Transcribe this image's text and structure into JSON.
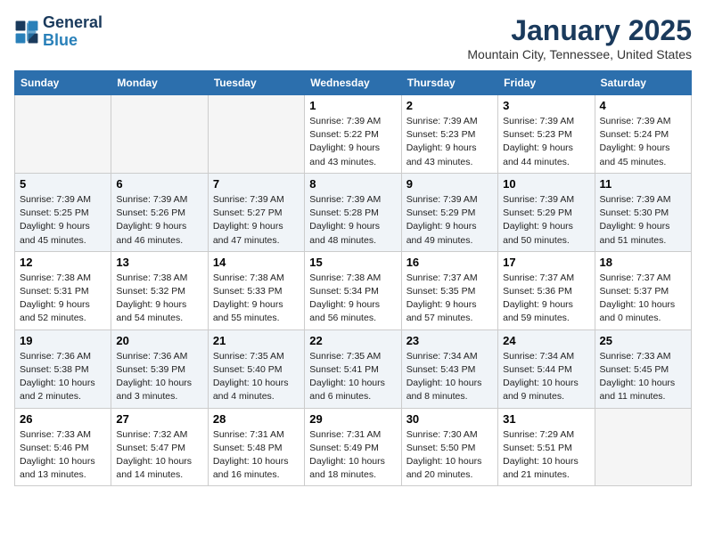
{
  "header": {
    "logo_line1": "General",
    "logo_line2": "Blue",
    "month_title": "January 2025",
    "location": "Mountain City, Tennessee, United States"
  },
  "days_of_week": [
    "Sunday",
    "Monday",
    "Tuesday",
    "Wednesday",
    "Thursday",
    "Friday",
    "Saturday"
  ],
  "weeks": [
    [
      {
        "day": "",
        "info": ""
      },
      {
        "day": "",
        "info": ""
      },
      {
        "day": "",
        "info": ""
      },
      {
        "day": "1",
        "info": "Sunrise: 7:39 AM\nSunset: 5:22 PM\nDaylight: 9 hours\nand 43 minutes."
      },
      {
        "day": "2",
        "info": "Sunrise: 7:39 AM\nSunset: 5:23 PM\nDaylight: 9 hours\nand 43 minutes."
      },
      {
        "day": "3",
        "info": "Sunrise: 7:39 AM\nSunset: 5:23 PM\nDaylight: 9 hours\nand 44 minutes."
      },
      {
        "day": "4",
        "info": "Sunrise: 7:39 AM\nSunset: 5:24 PM\nDaylight: 9 hours\nand 45 minutes."
      }
    ],
    [
      {
        "day": "5",
        "info": "Sunrise: 7:39 AM\nSunset: 5:25 PM\nDaylight: 9 hours\nand 45 minutes."
      },
      {
        "day": "6",
        "info": "Sunrise: 7:39 AM\nSunset: 5:26 PM\nDaylight: 9 hours\nand 46 minutes."
      },
      {
        "day": "7",
        "info": "Sunrise: 7:39 AM\nSunset: 5:27 PM\nDaylight: 9 hours\nand 47 minutes."
      },
      {
        "day": "8",
        "info": "Sunrise: 7:39 AM\nSunset: 5:28 PM\nDaylight: 9 hours\nand 48 minutes."
      },
      {
        "day": "9",
        "info": "Sunrise: 7:39 AM\nSunset: 5:29 PM\nDaylight: 9 hours\nand 49 minutes."
      },
      {
        "day": "10",
        "info": "Sunrise: 7:39 AM\nSunset: 5:29 PM\nDaylight: 9 hours\nand 50 minutes."
      },
      {
        "day": "11",
        "info": "Sunrise: 7:39 AM\nSunset: 5:30 PM\nDaylight: 9 hours\nand 51 minutes."
      }
    ],
    [
      {
        "day": "12",
        "info": "Sunrise: 7:38 AM\nSunset: 5:31 PM\nDaylight: 9 hours\nand 52 minutes."
      },
      {
        "day": "13",
        "info": "Sunrise: 7:38 AM\nSunset: 5:32 PM\nDaylight: 9 hours\nand 54 minutes."
      },
      {
        "day": "14",
        "info": "Sunrise: 7:38 AM\nSunset: 5:33 PM\nDaylight: 9 hours\nand 55 minutes."
      },
      {
        "day": "15",
        "info": "Sunrise: 7:38 AM\nSunset: 5:34 PM\nDaylight: 9 hours\nand 56 minutes."
      },
      {
        "day": "16",
        "info": "Sunrise: 7:37 AM\nSunset: 5:35 PM\nDaylight: 9 hours\nand 57 minutes."
      },
      {
        "day": "17",
        "info": "Sunrise: 7:37 AM\nSunset: 5:36 PM\nDaylight: 9 hours\nand 59 minutes."
      },
      {
        "day": "18",
        "info": "Sunrise: 7:37 AM\nSunset: 5:37 PM\nDaylight: 10 hours\nand 0 minutes."
      }
    ],
    [
      {
        "day": "19",
        "info": "Sunrise: 7:36 AM\nSunset: 5:38 PM\nDaylight: 10 hours\nand 2 minutes."
      },
      {
        "day": "20",
        "info": "Sunrise: 7:36 AM\nSunset: 5:39 PM\nDaylight: 10 hours\nand 3 minutes."
      },
      {
        "day": "21",
        "info": "Sunrise: 7:35 AM\nSunset: 5:40 PM\nDaylight: 10 hours\nand 4 minutes."
      },
      {
        "day": "22",
        "info": "Sunrise: 7:35 AM\nSunset: 5:41 PM\nDaylight: 10 hours\nand 6 minutes."
      },
      {
        "day": "23",
        "info": "Sunrise: 7:34 AM\nSunset: 5:43 PM\nDaylight: 10 hours\nand 8 minutes."
      },
      {
        "day": "24",
        "info": "Sunrise: 7:34 AM\nSunset: 5:44 PM\nDaylight: 10 hours\nand 9 minutes."
      },
      {
        "day": "25",
        "info": "Sunrise: 7:33 AM\nSunset: 5:45 PM\nDaylight: 10 hours\nand 11 minutes."
      }
    ],
    [
      {
        "day": "26",
        "info": "Sunrise: 7:33 AM\nSunset: 5:46 PM\nDaylight: 10 hours\nand 13 minutes."
      },
      {
        "day": "27",
        "info": "Sunrise: 7:32 AM\nSunset: 5:47 PM\nDaylight: 10 hours\nand 14 minutes."
      },
      {
        "day": "28",
        "info": "Sunrise: 7:31 AM\nSunset: 5:48 PM\nDaylight: 10 hours\nand 16 minutes."
      },
      {
        "day": "29",
        "info": "Sunrise: 7:31 AM\nSunset: 5:49 PM\nDaylight: 10 hours\nand 18 minutes."
      },
      {
        "day": "30",
        "info": "Sunrise: 7:30 AM\nSunset: 5:50 PM\nDaylight: 10 hours\nand 20 minutes."
      },
      {
        "day": "31",
        "info": "Sunrise: 7:29 AM\nSunset: 5:51 PM\nDaylight: 10 hours\nand 21 minutes."
      },
      {
        "day": "",
        "info": ""
      }
    ]
  ]
}
